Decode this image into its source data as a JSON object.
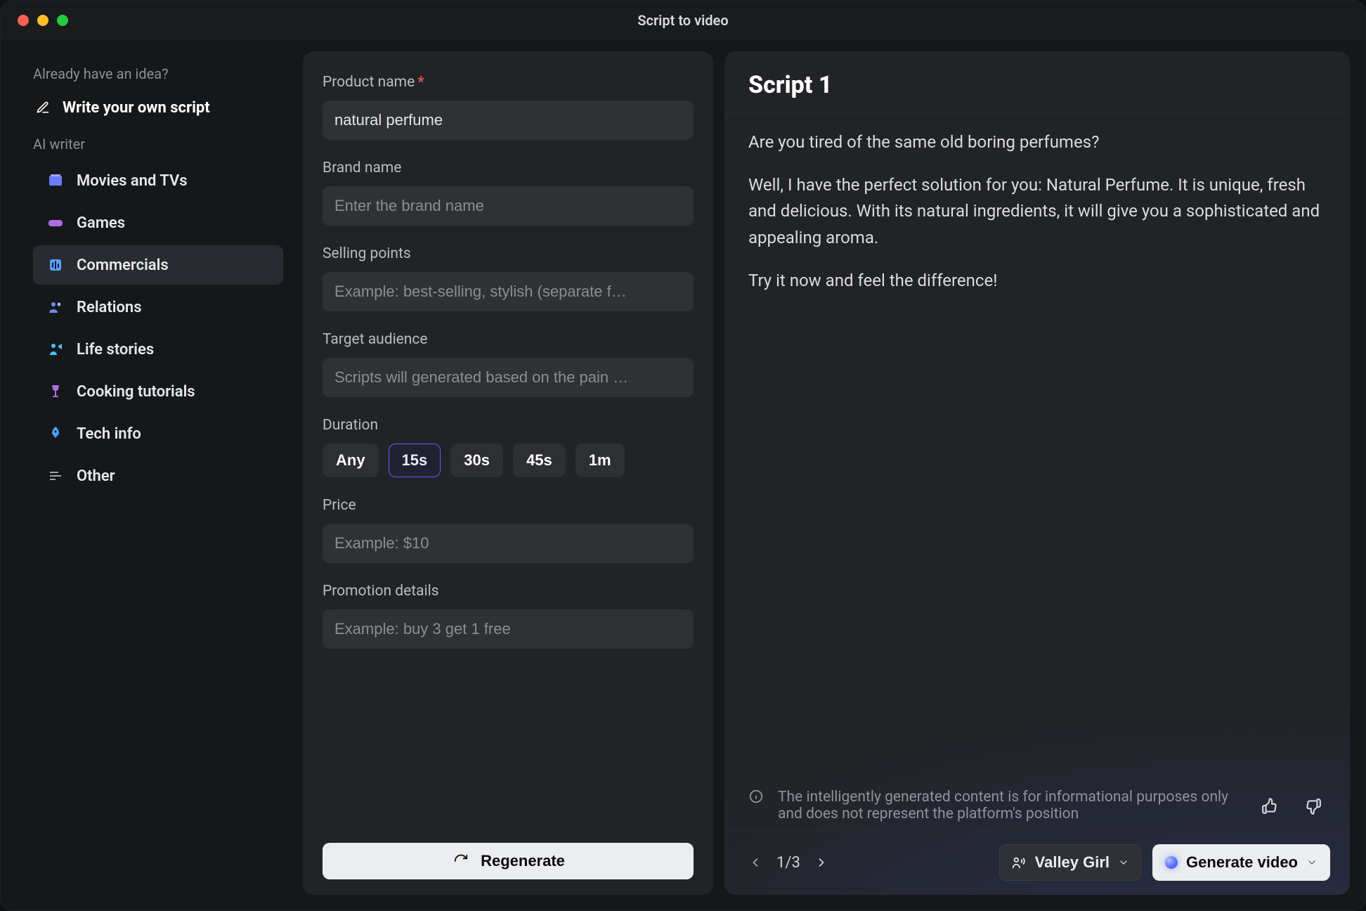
{
  "window": {
    "title": "Script to video"
  },
  "sidebar": {
    "idea_label": "Already have an idea?",
    "write_own": "Write your own script",
    "ai_label": "AI writer",
    "items": [
      {
        "label": "Movies and TVs",
        "active": false
      },
      {
        "label": "Games",
        "active": false
      },
      {
        "label": "Commercials",
        "active": true
      },
      {
        "label": "Relations",
        "active": false
      },
      {
        "label": "Life stories",
        "active": false
      },
      {
        "label": "Cooking tutorials",
        "active": false
      },
      {
        "label": "Tech info",
        "active": false
      },
      {
        "label": "Other",
        "active": false
      }
    ]
  },
  "form": {
    "product_name": {
      "label": "Product name",
      "required": true,
      "value": "natural perfume"
    },
    "brand_name": {
      "label": "Brand name",
      "placeholder": "Enter the brand name",
      "value": ""
    },
    "selling_points": {
      "label": "Selling points",
      "placeholder": "Example: best-selling, stylish (separate f…",
      "value": ""
    },
    "target_audience": {
      "label": "Target audience",
      "placeholder": "Scripts will generated based on the pain …",
      "value": ""
    },
    "duration": {
      "label": "Duration",
      "options": [
        "Any",
        "15s",
        "30s",
        "45s",
        "1m"
      ],
      "selected_index": 1
    },
    "price": {
      "label": "Price",
      "placeholder": "Example: $10",
      "value": ""
    },
    "promotion": {
      "label": "Promotion details",
      "placeholder": "Example: buy 3 get 1 free",
      "value": ""
    },
    "regenerate_label": "Regenerate"
  },
  "script": {
    "title": "Script 1",
    "paragraphs": [
      "Are you tired of the same old boring perfumes?",
      "Well, I have the perfect solution for you: Natural Perfume. It is unique, fresh and delicious. With its natural ingredients, it will give you a sophisticated and appealing aroma.",
      "Try it now and feel the difference!"
    ],
    "disclaimer": "The intelligently generated content is for informational purposes only and does not represent the platform's position",
    "pager": {
      "current": 1,
      "total": 3,
      "text": "1/3"
    },
    "voice_label": "Valley Girl",
    "generate_label": "Generate video"
  }
}
